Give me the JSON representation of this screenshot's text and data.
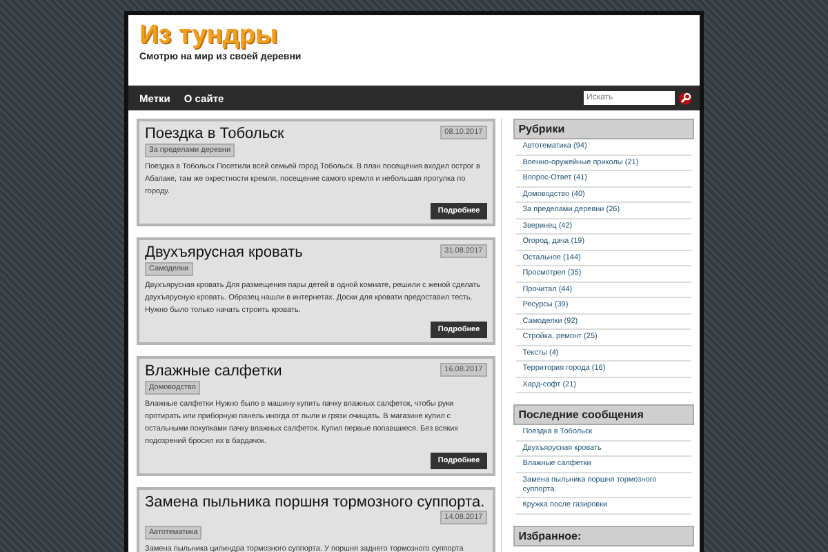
{
  "site": {
    "title": "Из тундры",
    "tagline": "Смотрю на мир из своей деревни"
  },
  "nav": {
    "items": [
      {
        "label": "Метки"
      },
      {
        "label": "О сайте"
      }
    ],
    "search": {
      "placeholder": "Искать"
    }
  },
  "posts": [
    {
      "title": "Поездка в Тобольск",
      "date": "08.10.2017",
      "category": "За пределами деревни",
      "excerpt": "Поездка в Тобольск Посетили всей семьей город Тобольск. В план посещения входил острог в Абалаке, там же окрестности кремля, посещение самого кремля и небольшая прогулка по городу.",
      "button": "Подробнее"
    },
    {
      "title": "Двухъярусная кровать",
      "date": "31.08.2017",
      "category": "Самоделки",
      "excerpt": "Двухъярусная кровать Для размещения пары детей в одной комнате, решили с женой сделать двухъярусную кровать. Образец нашли в интернетах. Доски для кровати предоставил тесть. Нужно было только начать строить кровать.",
      "button": "Подробнее"
    },
    {
      "title": "Влажные салфетки",
      "date": "16.08.2017",
      "category": "Домоводство",
      "excerpt": "Влажные салфетки Нужно было в машину купить пачку влажных салфеток, чтобы руки протирать или приборную панель иногда от пыли и грязи очищать. В магазине купил с остальными покупками пачку влажных салфеток. Купил первые попавшиеся. Без всяких подозрений бросил их в бардачок.",
      "button": "Подробнее"
    },
    {
      "title": "Замена пыльника поршня тормозного суппорта.",
      "date": "14.08.2017",
      "category": "Автотематика",
      "excerpt": "Замена пыльника цилиндра тормозного суппорта. У поршня заднего тормозного суппорта"
    }
  ],
  "sidebar": [
    {
      "title": "Рубрики",
      "items": [
        "Автотематика (94)",
        "Военно-оружейные приколы (21)",
        "Вопрос-Ответ (41)",
        "Домоводство (40)",
        "За пределами деревни (26)",
        "Зверинец (42)",
        "Огород, дача (19)",
        "Остальное (144)",
        "Просмотрел (35)",
        "Прочитал (44)",
        "Ресурсы (39)",
        "Самоделки (92)",
        "Стройка, ремонт (25)",
        "Тексты (4)",
        "Территория города (16)",
        "Хард-софт (21)"
      ]
    },
    {
      "title": "Последние сообщения",
      "items": [
        "Поездка в Тобольск",
        "Двухъярусная кровать",
        "Влажные салфетки",
        "Замена пыльника поршня тормозного суппорта.",
        "Кружка после газировки"
      ]
    },
    {
      "title": "Избранное:"
    }
  ]
}
